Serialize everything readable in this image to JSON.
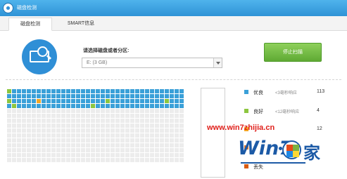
{
  "window": {
    "title": "磁盘检测"
  },
  "tabs": [
    {
      "label": "磁盘检测",
      "active": true
    },
    {
      "label": "SMART信息",
      "active": false
    }
  ],
  "drive": {
    "select_label": "请选择磁盘或者分区:",
    "selected_value": "E:  (3 GB)"
  },
  "actions": {
    "stop_label": "停止扫描"
  },
  "legend": [
    {
      "label": "优良",
      "desc": "<3毫秒响应",
      "count": "113",
      "color": "#3aa0d8"
    },
    {
      "label": "良好",
      "desc": "<12毫秒响应",
      "count": "4",
      "color": "#8dc63f"
    },
    {
      "label": "",
      "desc": "",
      "count": "12",
      "color": "#f5a623"
    },
    {
      "label": "",
      "desc": "",
      "count": "",
      "color": "#e87722"
    },
    {
      "label": "丢失",
      "desc": "",
      "count": "",
      "color": "#d95b10"
    }
  ],
  "block_colors": {
    "good": "#3aa0d8",
    "fine": "#8dc63f",
    "slow": "#f5a623",
    "pending": "#ececec"
  },
  "scan_pattern": [
    "fgggggggggggggggggggggggggggggggggggggggg",
    "gggggggggggggggggggggggggggggggggggggggg",
    "fgggggsgggggggggggggfgggggggggggfgggsgggg",
    "gfgggggggggggggggfggggggggggggggggggggg"
  ],
  "watermark": {
    "url": "www.win7zhijia.cn",
    "logo_text": "Win7",
    "logo_suffix": "家"
  }
}
